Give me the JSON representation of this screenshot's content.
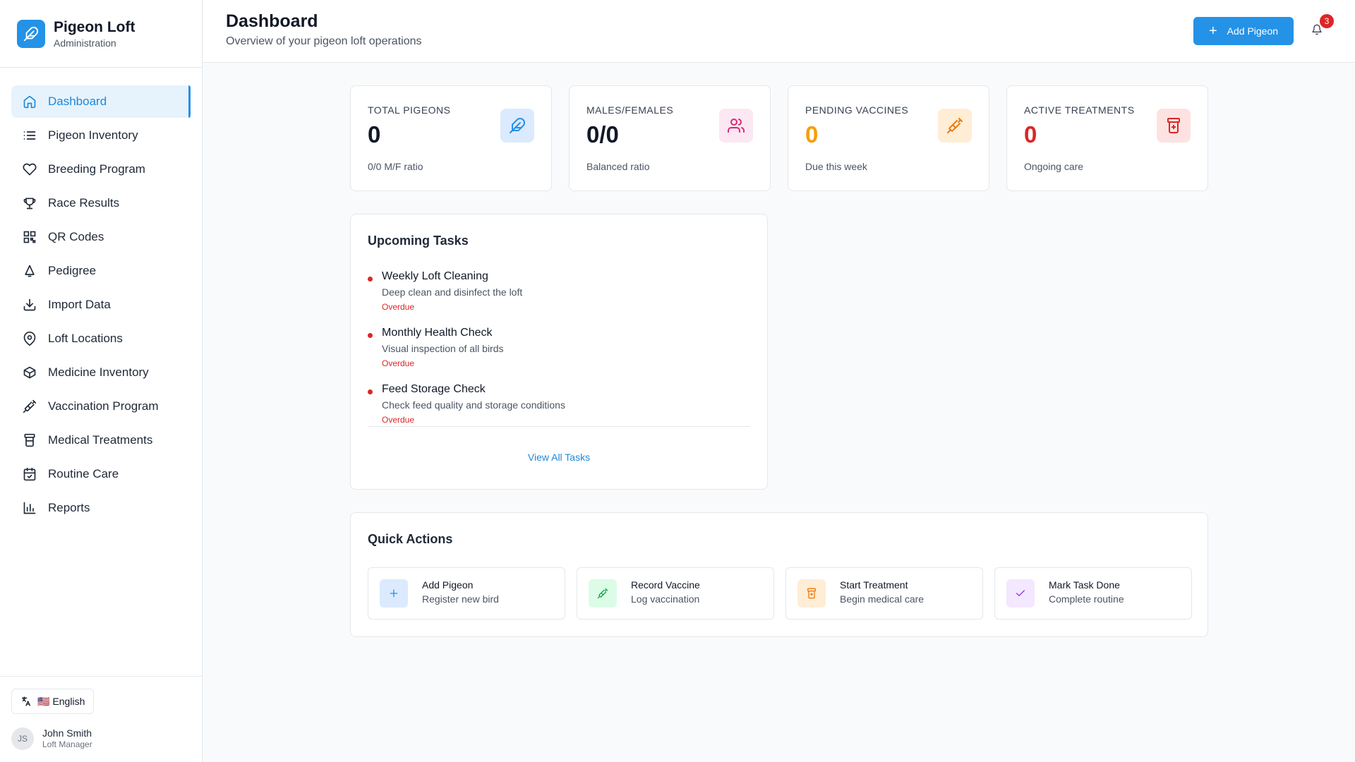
{
  "brand": {
    "title": "Pigeon Loft",
    "subtitle": "Administration"
  },
  "sidebar": {
    "items": [
      {
        "label": "Dashboard",
        "icon": "home-icon",
        "active": true
      },
      {
        "label": "Pigeon Inventory",
        "icon": "list-icon"
      },
      {
        "label": "Breeding Program",
        "icon": "heart-icon"
      },
      {
        "label": "Race Results",
        "icon": "trophy-icon"
      },
      {
        "label": "QR Codes",
        "icon": "qr-code-icon"
      },
      {
        "label": "Pedigree",
        "icon": "bell-tree-icon"
      },
      {
        "label": "Import Data",
        "icon": "download-icon"
      },
      {
        "label": "Loft Locations",
        "icon": "map-pin-icon"
      },
      {
        "label": "Medicine Inventory",
        "icon": "package-icon"
      },
      {
        "label": "Vaccination Program",
        "icon": "syringe-icon"
      },
      {
        "label": "Medical Treatments",
        "icon": "pill-bottle-icon"
      },
      {
        "label": "Routine Care",
        "icon": "calendar-check-icon"
      },
      {
        "label": "Reports",
        "icon": "bar-chart-icon"
      }
    ],
    "language": {
      "flag": "🇺🇸",
      "label": "English"
    },
    "user": {
      "initials": "JS",
      "name": "John Smith",
      "role": "Loft Manager"
    }
  },
  "header": {
    "title": "Dashboard",
    "subtitle": "Overview of your pigeon loft operations",
    "add_button": "Add Pigeon",
    "notification_count": "3"
  },
  "stats": [
    {
      "label": "TOTAL PIGEONS",
      "value": "0",
      "note": "0/0 M/F ratio",
      "icon": "bird-icon",
      "color": "#2492e6",
      "bg": "#dbeafe",
      "value_color": "#111827"
    },
    {
      "label": "MALES/FEMALES",
      "value": "0/0",
      "note": "Balanced ratio",
      "icon": "users-icon",
      "color": "#db2777",
      "bg": "#fce7f3",
      "value_color": "#111827"
    },
    {
      "label": "PENDING VACCINES",
      "value": "0",
      "note": "Due this week",
      "icon": "syringe-icon",
      "color": "#ea7a0c",
      "bg": "#ffedd5",
      "value_color": "#f59e0b"
    },
    {
      "label": "ACTIVE TREATMENTS",
      "value": "0",
      "note": "Ongoing care",
      "icon": "pill-bottle-icon",
      "color": "#dc2626",
      "bg": "#fee2e2",
      "value_color": "#dc2626"
    }
  ],
  "tasks": {
    "title": "Upcoming Tasks",
    "items": [
      {
        "title": "Weekly Loft Cleaning",
        "desc": "Deep clean and disinfect the loft",
        "status": "Overdue"
      },
      {
        "title": "Monthly Health Check",
        "desc": "Visual inspection of all birds",
        "status": "Overdue"
      },
      {
        "title": "Feed Storage Check",
        "desc": "Check feed quality and storage conditions",
        "status": "Overdue"
      }
    ],
    "view_all": "View All Tasks"
  },
  "quick_actions": {
    "title": "Quick Actions",
    "items": [
      {
        "title": "Add Pigeon",
        "desc": "Register new bird",
        "icon": "plus-icon",
        "color": "#2492e6",
        "bg": "#dbeafe"
      },
      {
        "title": "Record Vaccine",
        "desc": "Log vaccination",
        "icon": "syringe-icon",
        "color": "#16a34a",
        "bg": "#dcfce7"
      },
      {
        "title": "Start Treatment",
        "desc": "Begin medical care",
        "icon": "pill-bottle-icon",
        "color": "#ea7a0c",
        "bg": "#ffedd5"
      },
      {
        "title": "Mark Task Done",
        "desc": "Complete routine",
        "icon": "check-icon",
        "color": "#9333ea",
        "bg": "#f3e8ff"
      }
    ]
  }
}
